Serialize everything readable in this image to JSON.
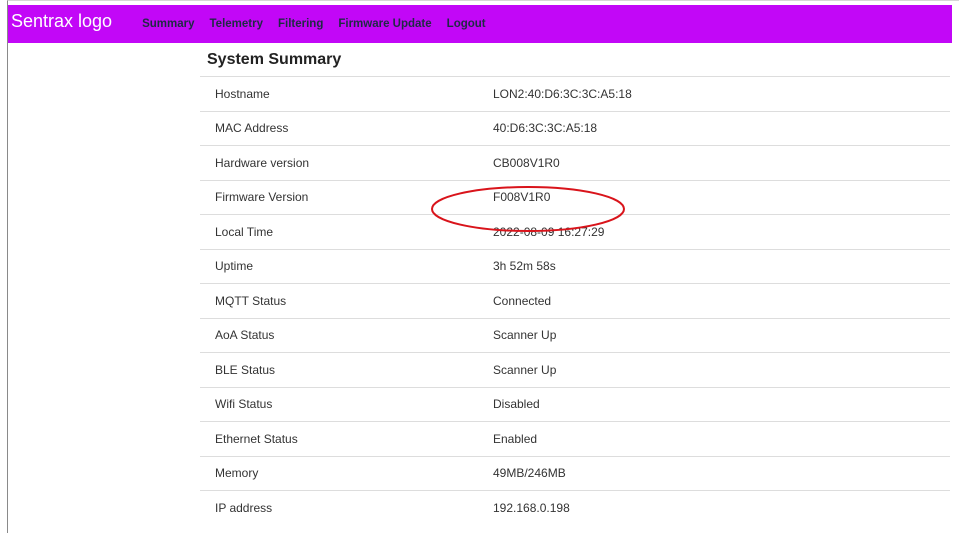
{
  "navbar": {
    "brand": "Sentrax logo",
    "links": [
      {
        "label": "Summary"
      },
      {
        "label": "Telemetry"
      },
      {
        "label": "Filtering"
      },
      {
        "label": "Firmware Update"
      },
      {
        "label": "Logout"
      }
    ],
    "background_color": "#c207f7"
  },
  "main": {
    "title": "System Summary",
    "rows": [
      {
        "label": "Hostname",
        "value": "LON2:40:D6:3C:3C:A5:18"
      },
      {
        "label": "MAC Address",
        "value": "40:D6:3C:3C:A5:18"
      },
      {
        "label": "Hardware version",
        "value": "CB008V1R0"
      },
      {
        "label": "Firmware Version",
        "value": "F008V1R0"
      },
      {
        "label": "Local Time",
        "value": "2022-08-09 16:27:29"
      },
      {
        "label": "Uptime",
        "value": "3h 52m 58s"
      },
      {
        "label": "MQTT Status",
        "value": "Connected"
      },
      {
        "label": "AoA Status",
        "value": "Scanner Up"
      },
      {
        "label": "BLE Status",
        "value": "Scanner Up"
      },
      {
        "label": "Wifi Status",
        "value": "Disabled"
      },
      {
        "label": "Ethernet Status",
        "value": "Enabled"
      },
      {
        "label": "Memory",
        "value": "49MB/246MB"
      },
      {
        "label": "IP address",
        "value": "192.168.0.198"
      }
    ]
  },
  "annotation": {
    "highlight_color": "#d9141b"
  }
}
